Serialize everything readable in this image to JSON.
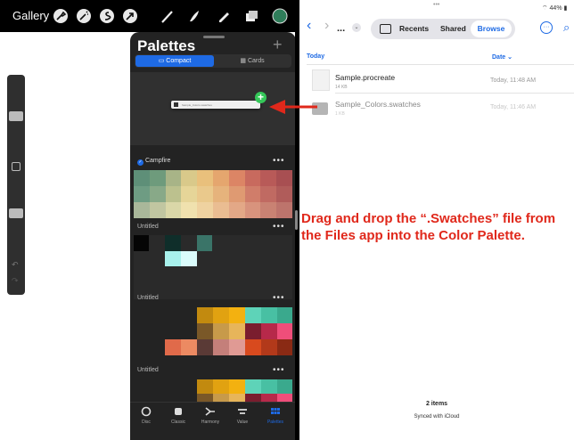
{
  "procreate": {
    "gallery_label": "Gallery",
    "toolbar_icons": [
      "wrench-icon",
      "magic-wand-icon",
      "selection-icon",
      "transform-arrow-icon",
      "brush-icon",
      "smudge-icon",
      "eraser-icon",
      "layers-icon",
      "color-swatch-icon"
    ],
    "palettes": {
      "title": "Palettes",
      "add_symbol": "+",
      "view_compact": "Compact",
      "view_cards": "Cards",
      "dragged_file_label": "Sample_Colors.swatches",
      "palette_list": [
        {
          "name": "Campfire",
          "default": true
        },
        {
          "name": "Untitled"
        },
        {
          "name": "Untitled"
        },
        {
          "name": "Untitled"
        }
      ],
      "more_symbol": "•••",
      "tabs": [
        "Disc",
        "Classic",
        "Harmony",
        "Value",
        "Palettes"
      ],
      "active_tab": "Palettes",
      "colors": {
        "campfire": [
          "#5e8f78",
          "#6e9b7c",
          "#a8b487",
          "#d9c98a",
          "#e9c07c",
          "#e5a66e",
          "#dc8565",
          "#c86a5e",
          "#b85a58",
          "#a84f52",
          "#6e9c83",
          "#88a988",
          "#bcc18e",
          "#e6d598",
          "#eac98c",
          "#e6b37c",
          "#df9a72",
          "#d07d6a",
          "#c06a62",
          "#b05c5a",
          "#a9b79a",
          "#c1c6a1",
          "#dad7a8",
          "#f0e1ae",
          "#efd2a0",
          "#eabd92",
          "#e3a887",
          "#d8937d",
          "#c98273",
          "#bd746c"
        ]
      }
    }
  },
  "files": {
    "nav_back": "‹",
    "nav_forward": "›",
    "path_ellipsis": "...",
    "tabs": {
      "recents": "Recents",
      "shared": "Shared",
      "browse": "Browse"
    },
    "section": "Today",
    "sort": "Date ⌄",
    "items": [
      {
        "name": "Sample.procreate",
        "size": "14 KB",
        "date": "Today, 11:48 AM"
      },
      {
        "name": "Sample_Colors.swatches",
        "size": "1 KB",
        "date": "Today, 11:46 AM"
      }
    ],
    "footer_count": "2 items",
    "footer_sync": "Synced with iCloud",
    "status_battery": "44%"
  },
  "callout": "Drag and drop the “.Swatches” file from the Files app into the Color Palette.",
  "accent": "#1e6ae4",
  "callout_color": "#e0281b"
}
